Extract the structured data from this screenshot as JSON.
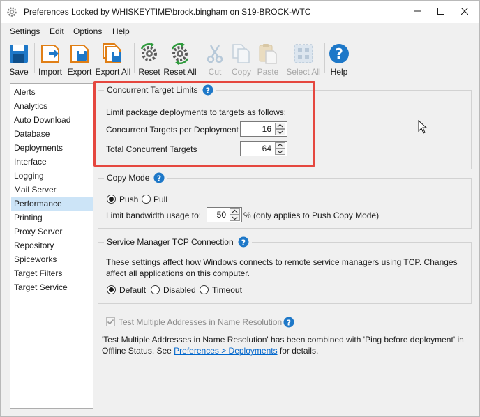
{
  "window": {
    "title": "Preferences Locked by WHISKEYTIME\\brock.bingham on S19-BROCK-WTC",
    "controls": {
      "minimize": "minimize",
      "maximize": "maximize",
      "close": "close"
    }
  },
  "menu": {
    "items": [
      "Settings",
      "Edit",
      "Options",
      "Help"
    ]
  },
  "toolbar": {
    "save": "Save",
    "import": "Import",
    "export": "Export",
    "export_all": "Export All",
    "reset": "Reset",
    "reset_all": "Reset All",
    "cut": "Cut",
    "copy": "Copy",
    "paste": "Paste",
    "select_all": "Select All",
    "help": "Help"
  },
  "sidebar": {
    "items": [
      "Alerts",
      "Analytics",
      "Auto Download",
      "Database",
      "Deployments",
      "Interface",
      "Logging",
      "Mail Server",
      "Performance",
      "Printing",
      "Proxy Server",
      "Repository",
      "Spiceworks",
      "Target Filters",
      "Target Service"
    ],
    "selected": "Performance"
  },
  "concurrent": {
    "title": "Concurrent Target Limits",
    "description": "Limit package deployments to targets as follows:",
    "per_deployment_label": "Concurrent Targets per Deployment",
    "per_deployment_value": "16",
    "total_label": "Total Concurrent Targets",
    "total_value": "64"
  },
  "copy_mode": {
    "title": "Copy Mode",
    "push_label": "Push",
    "pull_label": "Pull",
    "selected": "Push",
    "bandwidth_label": "Limit bandwidth usage to:",
    "bandwidth_value": "50",
    "bandwidth_suffix": "% (only applies to Push Copy Mode)"
  },
  "tcp": {
    "title": "Service Manager TCP Connection",
    "description_line1": "These settings affect how Windows connects to remote service managers using TCP. Changes",
    "description_line2": "affect all applications on this computer.",
    "default_label": "Default",
    "disabled_label": "Disabled",
    "timeout_label": "Timeout",
    "selected": "Default"
  },
  "name_resolution": {
    "checkbox_label": "Test Multiple Addresses in Name Resolution",
    "checked": true,
    "note_line1": "'Test Multiple Addresses in Name Resolution' has been combined with 'Ping before deployment' in",
    "note_line2_prefix": "Offline Status. See ",
    "note_link": "Preferences > Deployments",
    "note_line2_suffix": " for details."
  },
  "colors": {
    "accent": "#0078d7",
    "selection": "#cce4f7",
    "highlight": "#e5473f",
    "help_blue": "#1e78c8"
  }
}
